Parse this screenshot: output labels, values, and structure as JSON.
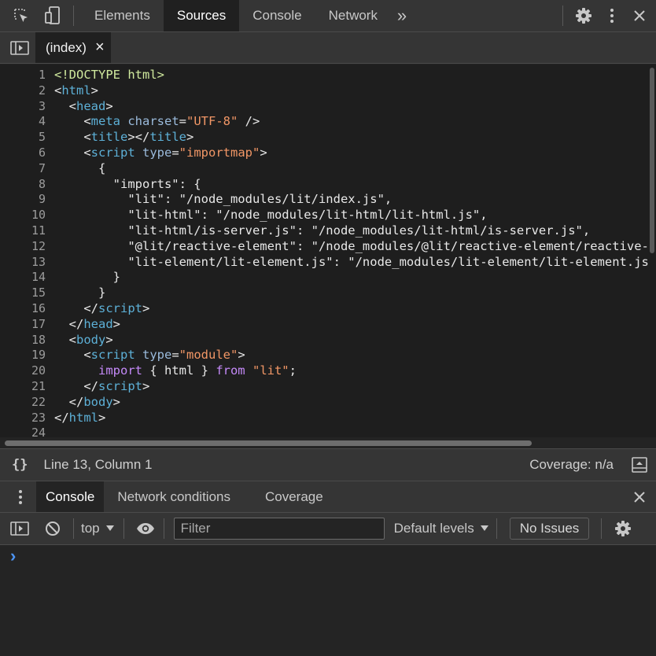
{
  "toolbar": {
    "tabs": [
      "Elements",
      "Sources",
      "Console",
      "Network"
    ],
    "active_tab": "Sources",
    "more_glyph": "»"
  },
  "editor": {
    "file_tab": "(index)",
    "close_glyph": "×",
    "line_numbers": [
      "1",
      "2",
      "3",
      "4",
      "5",
      "6",
      "7",
      "8",
      "9",
      "10",
      "11",
      "12",
      "13",
      "14",
      "15",
      "16",
      "17",
      "18",
      "19",
      "20",
      "21",
      "22",
      "23",
      "24"
    ],
    "lines": [
      [
        [
          "dt",
          "<!DOCTYPE html>"
        ]
      ],
      [
        [
          "p",
          "<"
        ],
        [
          "tg",
          "html"
        ],
        [
          "p",
          ">"
        ]
      ],
      [
        [
          "p",
          "  <"
        ],
        [
          "tg",
          "head"
        ],
        [
          "p",
          ">"
        ]
      ],
      [
        [
          "p",
          "    <"
        ],
        [
          "tg",
          "meta "
        ],
        [
          "at",
          "charset"
        ],
        [
          "p",
          "="
        ],
        [
          "st",
          "\"UTF-8\""
        ],
        [
          "p",
          " />"
        ]
      ],
      [
        [
          "p",
          "    <"
        ],
        [
          "tg",
          "title"
        ],
        [
          "p",
          "></"
        ],
        [
          "tg",
          "title"
        ],
        [
          "p",
          ">"
        ]
      ],
      [
        [
          "p",
          "    <"
        ],
        [
          "tg",
          "script "
        ],
        [
          "at",
          "type"
        ],
        [
          "p",
          "="
        ],
        [
          "st",
          "\"importmap\""
        ],
        [
          "p",
          ">"
        ]
      ],
      [
        [
          "p",
          "      {"
        ]
      ],
      [
        [
          "p",
          "        \"imports\": {"
        ]
      ],
      [
        [
          "p",
          "          \"lit\": \"/node_modules/lit/index.js\","
        ]
      ],
      [
        [
          "p",
          "          \"lit-html\": \"/node_modules/lit-html/lit-html.js\","
        ]
      ],
      [
        [
          "p",
          "          \"lit-html/is-server.js\": \"/node_modules/lit-html/is-server.js\","
        ]
      ],
      [
        [
          "p",
          "          \"@lit/reactive-element\": \"/node_modules/@lit/reactive-element/reactive-element.js\","
        ]
      ],
      [
        [
          "p",
          "          \"lit-element/lit-element.js\": \"/node_modules/lit-element/lit-element.js\""
        ]
      ],
      [
        [
          "p",
          "        }"
        ]
      ],
      [
        [
          "p",
          "      }"
        ]
      ],
      [
        [
          "p",
          "    </"
        ],
        [
          "tg",
          "script"
        ],
        [
          "p",
          ">"
        ]
      ],
      [
        [
          "p",
          "  </"
        ],
        [
          "tg",
          "head"
        ],
        [
          "p",
          ">"
        ]
      ],
      [
        [
          "p",
          "  <"
        ],
        [
          "tg",
          "body"
        ],
        [
          "p",
          ">"
        ]
      ],
      [
        [
          "p",
          "    <"
        ],
        [
          "tg",
          "script "
        ],
        [
          "at",
          "type"
        ],
        [
          "p",
          "="
        ],
        [
          "st",
          "\"module\""
        ],
        [
          "p",
          ">"
        ]
      ],
      [
        [
          "kw",
          "      import"
        ],
        [
          "p",
          " { html } "
        ],
        [
          "kw",
          "from"
        ],
        [
          "p",
          " "
        ],
        [
          "st",
          "\"lit\""
        ],
        [
          "p",
          ";"
        ]
      ],
      [
        [
          "p",
          "    </"
        ],
        [
          "tg",
          "script"
        ],
        [
          "p",
          ">"
        ]
      ],
      [
        [
          "p",
          "  </"
        ],
        [
          "tg",
          "body"
        ],
        [
          "p",
          ">"
        ]
      ],
      [
        [
          "p",
          "</"
        ],
        [
          "tg",
          "html"
        ],
        [
          "p",
          ">"
        ]
      ],
      [
        [
          "p",
          ""
        ]
      ]
    ]
  },
  "status": {
    "braces": "{}",
    "position": "Line 13, Column 1",
    "coverage": "Coverage: n/a"
  },
  "drawer": {
    "tabs": [
      "Console",
      "Network conditions",
      "Coverage"
    ],
    "active_tab": "Console"
  },
  "console_toolbar": {
    "context": "top",
    "filter_placeholder": "Filter",
    "levels": "Default levels",
    "issues": "No Issues"
  },
  "console": {
    "prompt": "›"
  },
  "colors": {
    "tag": "#5db0d7",
    "attribute": "#9bbbdc",
    "string": "#f29766",
    "keyword": "#c58af9",
    "doctype": "#d0ea9e"
  }
}
